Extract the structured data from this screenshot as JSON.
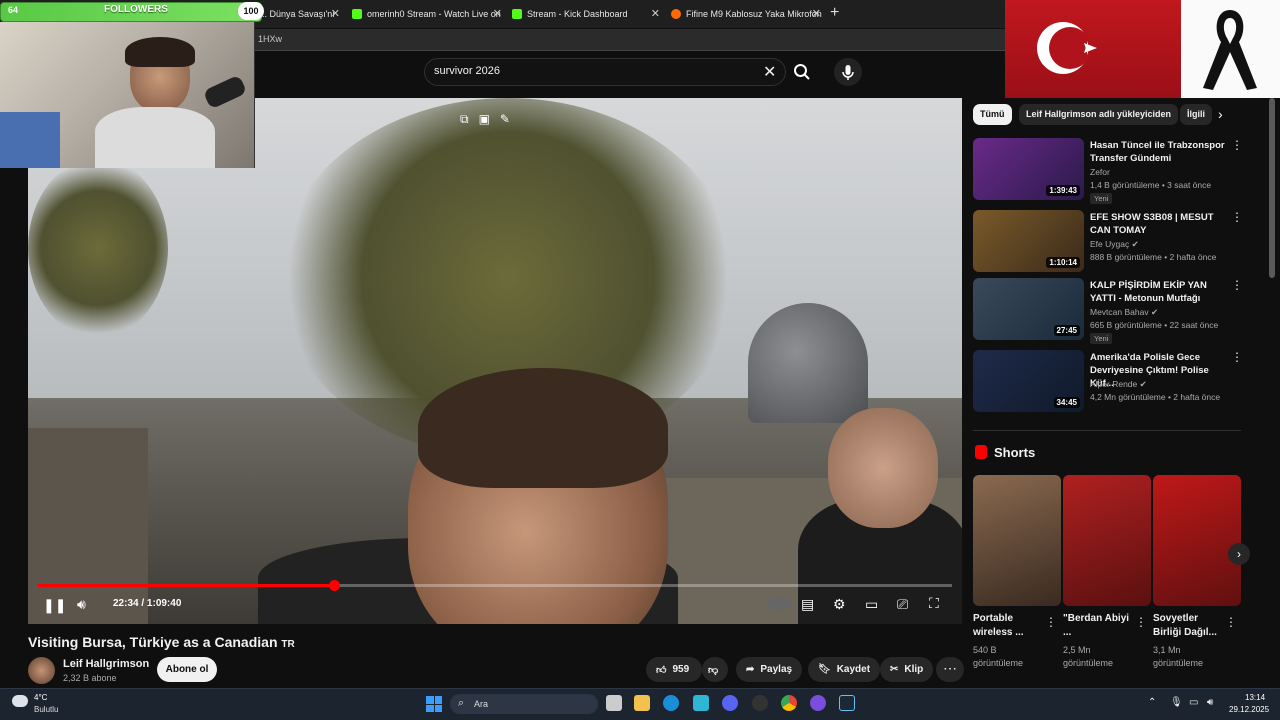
{
  "overlay": {
    "followers_label": "FOLLOWERS",
    "followers_current": "64",
    "followers_goal": "100"
  },
  "browser": {
    "tabs": [
      {
        "label": "Bu Ada Nedir... Dünya Savaşı'nı",
        "favicon": "youtube-icon",
        "color": "#ff0000"
      },
      {
        "label": "omerinh0 Stream - Watch Live on",
        "favicon": "kick-icon",
        "color": "#53fc18"
      },
      {
        "label": "Stream - Kick Dashboard",
        "favicon": "kick-icon",
        "color": "#53fc18"
      },
      {
        "label": "Fifine M9 Kablosuz Yaka Mikrofon",
        "favicon": "shop-icon",
        "color": "#ff6a00"
      }
    ],
    "new_tab": "+",
    "address_fragment": "1HXw"
  },
  "search": {
    "query": "survivor 2026"
  },
  "video": {
    "title": "Visiting Bursa, Türkiye as a Canadian",
    "title_suffix": "TR",
    "current_time": "22:34",
    "duration": "1:09:40",
    "progress_fraction": 0.324,
    "channel_name": "Leif Hallgrimson",
    "channel_subs": "2,32 B abone",
    "subscribe_label": "Abone ol",
    "likes": "959",
    "share_label": "Paylaş",
    "save_label": "Kaydet",
    "clip_label": "Klip"
  },
  "sidebar": {
    "chips": [
      {
        "label": "Tümü",
        "active": true
      },
      {
        "label": "Leif Hallgrimson adlı yükleyiciden",
        "active": false
      },
      {
        "label": "İlgili",
        "active": false
      }
    ],
    "recommended": [
      {
        "title": "Hasan Tüncel ile Trabzonspor Transfer Gündemi",
        "channel": "Zefor",
        "meta": "1,4 B görüntüleme • 3 saat önce",
        "badge": "Yeni",
        "duration": "1:39:43",
        "thumb": "#6a2a8a",
        "verified": false
      },
      {
        "title": "EFE SHOW S3B08 | MESUT CAN TOMAY",
        "channel": "Efe Uygaç",
        "meta": "888 B görüntüleme • 2 hafta önce",
        "badge": "",
        "duration": "1:10:14",
        "thumb": "#7a5a2a",
        "verified": true
      },
      {
        "title": "KALP PİŞİRDİM EKİP YAN YATTI - Metonun Mutfağı",
        "channel": "Mevtcan Bahav",
        "meta": "665 B görüntüleme • 22 saat önce",
        "badge": "Yeni",
        "duration": "27:45",
        "thumb": "#3a4a5a",
        "verified": true
      },
      {
        "title": "Amerika'da Polisle Gece Devriyesine Çıktım! Polise Küf...",
        "channel": "Alper Rende",
        "meta": "4,2 Mn görüntüleme • 2 hafta önce",
        "badge": "",
        "duration": "34:45",
        "thumb": "#1f2a4a",
        "verified": true
      }
    ],
    "shorts_title": "Shorts",
    "shorts": [
      {
        "title": "Portable wireless ...",
        "views": "540 B görüntüleme",
        "thumb": "#8a6a50"
      },
      {
        "title": "\"Berdan Abiyi ...",
        "views": "2,5 Mn görüntüleme",
        "thumb": "#b02020"
      },
      {
        "title": "Sovyetler Birliği Dağıl...",
        "views": "3,1 Mn görüntüleme",
        "thumb": "#c01818"
      }
    ]
  },
  "taskbar": {
    "weather_temp": "4°C",
    "weather_desc": "Bulutlu",
    "search_placeholder": "Ara",
    "time": "13:14",
    "date": "29.12.2025"
  }
}
